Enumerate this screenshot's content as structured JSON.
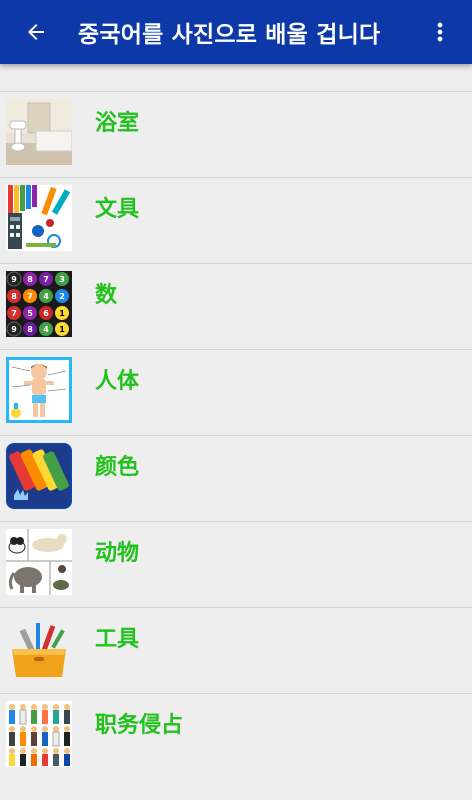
{
  "header": {
    "title": "중국어를 사진으로 배울 겁니다",
    "back_icon": "arrow-left-icon",
    "menu_icon": "more-vert-icon",
    "bar_color": "#0d39a8"
  },
  "label_color": "#22c11d",
  "categories": [
    {
      "label": "浴室",
      "icon": "bathroom-icon"
    },
    {
      "label": "文具",
      "icon": "stationery-icon"
    },
    {
      "label": "数",
      "icon": "numbers-icon"
    },
    {
      "label": "人体",
      "icon": "human-body-icon"
    },
    {
      "label": "颜色",
      "icon": "colors-icon"
    },
    {
      "label": "动物",
      "icon": "animals-icon"
    },
    {
      "label": "工具",
      "icon": "tools-icon"
    },
    {
      "label": "职务侵占",
      "icon": "occupations-icon"
    }
  ]
}
